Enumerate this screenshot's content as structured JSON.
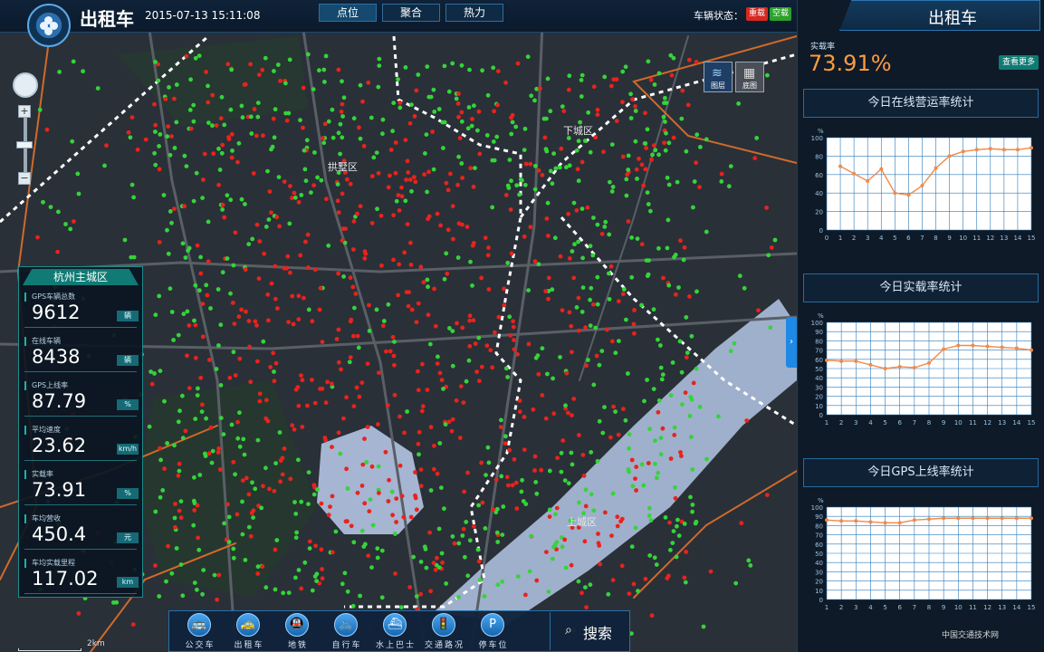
{
  "header": {
    "app_title": "出租车",
    "datetime": "2015-07-13 15:11:08",
    "tabs": [
      {
        "label": "点位",
        "active": true
      },
      {
        "label": "聚合",
        "active": false
      },
      {
        "label": "热力",
        "active": false
      }
    ],
    "status_label": "车辆状态：",
    "status_badges": [
      {
        "label": "重载",
        "color": "#d8281f"
      },
      {
        "label": "空载",
        "color": "#2ca12c"
      }
    ]
  },
  "map": {
    "districts": [
      "拱墅区",
      "下城区",
      "上城区"
    ],
    "layer_buttons": [
      "图层",
      "底图"
    ],
    "scale_label": "2km",
    "zoom_in": "+",
    "zoom_out": "−",
    "collapse_icon": "›"
  },
  "left_panel": {
    "title": "杭州主城区",
    "stats": [
      {
        "label": "GPS车辆总数",
        "value": "9612",
        "unit": "辆"
      },
      {
        "label": "在线车辆",
        "value": "8438",
        "unit": "辆"
      },
      {
        "label": "GPS上线率",
        "value": "87.79",
        "unit": "%"
      },
      {
        "label": "平均速度",
        "value": "23.62",
        "unit": "km/h"
      },
      {
        "label": "实载率",
        "value": "73.91",
        "unit": "%"
      },
      {
        "label": "车均营收",
        "value": "450.4",
        "unit": "元"
      },
      {
        "label": "车均实载里程",
        "value": "117.02",
        "unit": "km"
      }
    ]
  },
  "toolbar": {
    "tools": [
      {
        "label": "公交车",
        "icon": "bus-icon",
        "glyph": "🚌"
      },
      {
        "label": "出租车",
        "icon": "taxi-icon",
        "glyph": "🚕"
      },
      {
        "label": "地铁",
        "icon": "metro-icon",
        "glyph": "🚇"
      },
      {
        "label": "自行车",
        "icon": "bicycle-icon",
        "glyph": "🚲"
      },
      {
        "label": "水上巴士",
        "icon": "water-bus-icon",
        "glyph": "⛴"
      },
      {
        "label": "交通路况",
        "icon": "traffic-light-icon",
        "glyph": "🚦"
      },
      {
        "label": "停车位",
        "icon": "parking-icon",
        "glyph": "P"
      }
    ],
    "search_label": "搜索"
  },
  "right_panel": {
    "title": "出租车",
    "load_rate_label": "实载率",
    "load_rate_value": "73.91%",
    "more_button": "查看更多"
  },
  "colors": {
    "loaded_taxi": "#e8231c",
    "empty_taxi": "#35d43a",
    "chart_line": "#f08a4b",
    "accent": "#1e88e5"
  },
  "chart_data": [
    {
      "type": "line",
      "title": "今日在线营运率统计",
      "ylabel": "%",
      "x": [
        1,
        2,
        3,
        4,
        5,
        6,
        7,
        8,
        9,
        10,
        11,
        12,
        13,
        14,
        15
      ],
      "y": [
        69,
        61,
        53,
        66,
        40,
        38,
        48,
        67,
        80,
        85,
        87,
        88,
        87,
        87,
        89
      ],
      "xticks": [
        0,
        1,
        2,
        3,
        4,
        5,
        6,
        7,
        8,
        9,
        10,
        11,
        12,
        13,
        14,
        15
      ],
      "yticks": [
        0,
        20,
        40,
        60,
        80,
        100
      ],
      "xlim": [
        0,
        15
      ],
      "ylim": [
        0,
        100
      ],
      "grid": true
    },
    {
      "type": "line",
      "title": "今日实载率统计",
      "ylabel": "%",
      "x": [
        1,
        2,
        3,
        4,
        5,
        6,
        7,
        8,
        9,
        10,
        11,
        12,
        13,
        14,
        15
      ],
      "y": [
        59,
        58,
        58,
        54,
        50,
        52,
        51,
        56,
        71,
        75,
        75,
        74,
        73,
        72,
        70
      ],
      "xticks": [
        1,
        2,
        3,
        4,
        5,
        6,
        7,
        8,
        9,
        10,
        11,
        12,
        13,
        14,
        15
      ],
      "yticks": [
        0,
        10,
        20,
        30,
        40,
        50,
        60,
        70,
        80,
        90,
        100
      ],
      "xlim": [
        1,
        15
      ],
      "ylim": [
        0,
        100
      ],
      "grid": true
    },
    {
      "type": "line",
      "title": "今日GPS上线率统计",
      "ylabel": "%",
      "x": [
        1,
        2,
        3,
        4,
        5,
        6,
        7,
        8,
        9,
        10,
        11,
        12,
        13,
        14,
        15
      ],
      "y": [
        86,
        85,
        85,
        84,
        83,
        83,
        86,
        87,
        88,
        88,
        88,
        88,
        88,
        88,
        88
      ],
      "xticks": [
        1,
        2,
        3,
        4,
        5,
        6,
        7,
        8,
        9,
        10,
        11,
        12,
        13,
        14,
        15
      ],
      "yticks": [
        0,
        10,
        20,
        30,
        40,
        50,
        60,
        70,
        80,
        90,
        100
      ],
      "xlim": [
        1,
        15
      ],
      "ylim": [
        0,
        100
      ],
      "grid": true
    }
  ]
}
